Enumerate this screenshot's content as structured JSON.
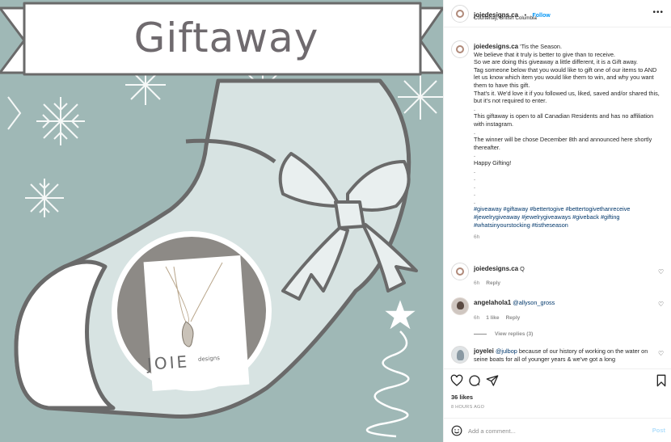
{
  "image": {
    "banner_text": "Giftaway",
    "card_brand": "JOIE",
    "card_brand_sub": "designs",
    "colors": {
      "background": "#9fb8b6",
      "banner": "#ffffff",
      "outline": "#6a6a6a"
    }
  },
  "header": {
    "username": "joiedesigns.ca",
    "separator": "•",
    "follow_label": "Follow",
    "location": "Courtenay, British Columbia"
  },
  "caption": {
    "username": "joiedesigns.ca",
    "text": "'Tis the Season.\nWe believe that it truly is better to give than to receive.\nSo we are doing this giveaway a little different, it is a Gift away.\nTag someone below that you would like to gift one of our items to AND let us know which item you would like them to win, and why you want them to have this gift.\nThat's it. We'd love it if you followed us, liked, saved and/or shared this, but it's not required to enter.\n.\nThis giftaway is open to all Canadian Residents and has no affiliation with instagram.\n.\nThe winner will be chose December 8th and announced here shortly thereafter.\n.\nHappy Gifting!\n.\n.\n.\n.\n.",
    "hashtags": "#giveaway #giftaway #bettertogive #bettertogivethanreceive #jewelrygiveaway #jewelrygiveaways #giveback #gifting #whatsinyourstocking #tistheseason",
    "time": "6h"
  },
  "comments": [
    {
      "username": "joiedesigns.ca",
      "text": "Q",
      "time": "6h",
      "reply": "Reply"
    },
    {
      "username": "angelahola1",
      "mention": "@allyson_gross",
      "time": "6h",
      "likes": "1 like",
      "reply": "Reply",
      "view_replies": "View replies (3)"
    },
    {
      "username": "joyelei",
      "mention": "@julbop",
      "text": "because of our history of working on the water on seine boats for all of younger years & we've got a long"
    }
  ],
  "footer": {
    "likes": "36 likes",
    "time": "8 HOURS AGO",
    "comment_placeholder": "Add a comment...",
    "post_label": "Post"
  }
}
